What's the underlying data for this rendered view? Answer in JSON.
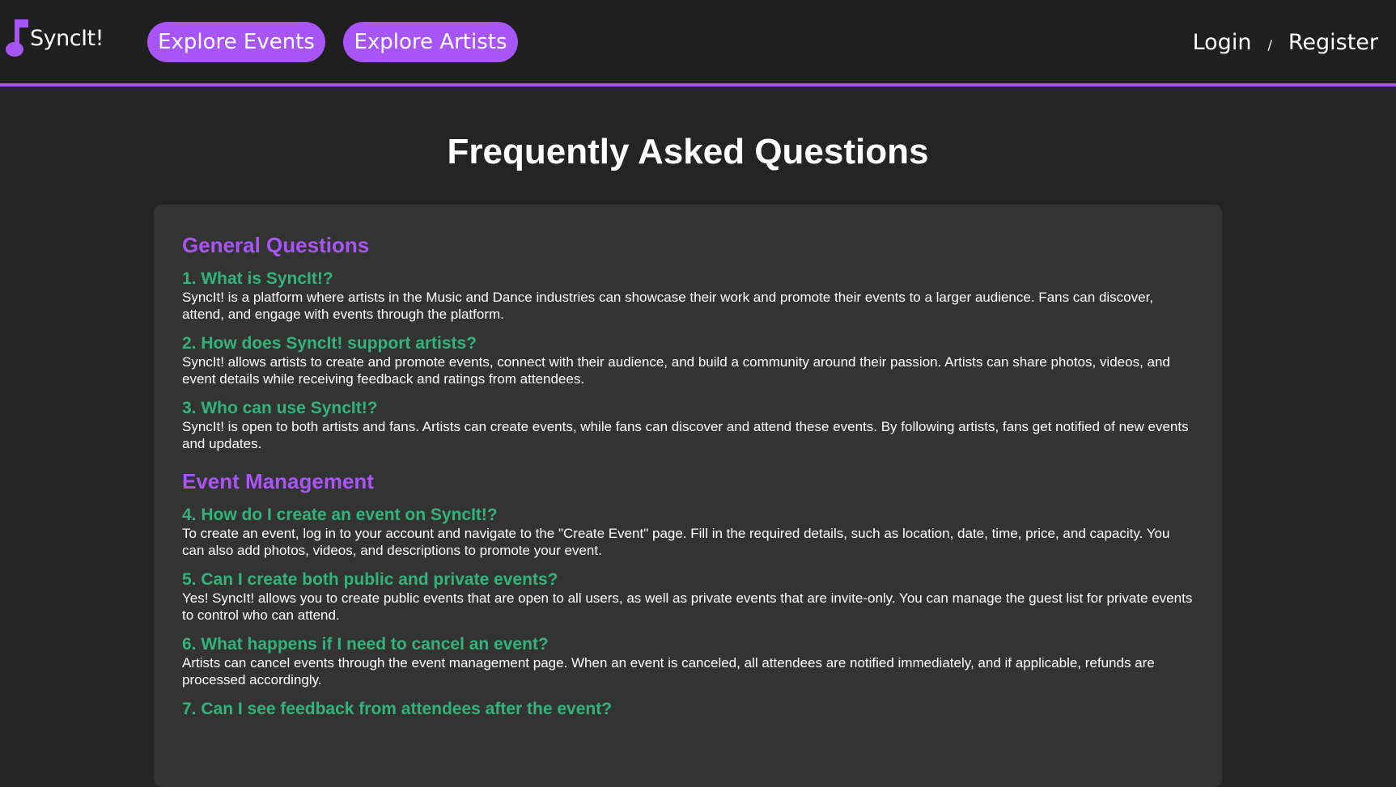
{
  "nav": {
    "logo_text": "SyncIt!",
    "explore_events": "Explore Events",
    "explore_artists": "Explore Artists",
    "login": "Login",
    "separator": "/",
    "register": "Register"
  },
  "colors": {
    "accent": "#a855f7",
    "question": "#34b27d",
    "background": "#242424",
    "card": "#333333"
  },
  "page": {
    "title": "Frequently Asked Questions"
  },
  "sections": [
    {
      "heading": "General Questions",
      "items": [
        {
          "question": "1. What is SyncIt!?",
          "answer": "SyncIt! is a platform where artists in the Music and Dance industries can showcase their work and promote their events to a larger audience. Fans can discover, attend, and engage with events through the platform."
        },
        {
          "question": "2. How does SyncIt! support artists?",
          "answer": "SyncIt! allows artists to create and promote events, connect with their audience, and build a community around their passion. Artists can share photos, videos, and event details while receiving feedback and ratings from attendees."
        },
        {
          "question": "3. Who can use SyncIt!?",
          "answer": "SyncIt! is open to both artists and fans. Artists can create events, while fans can discover and attend these events. By following artists, fans get notified of new events and updates."
        }
      ]
    },
    {
      "heading": "Event Management",
      "items": [
        {
          "question": "4. How do I create an event on SyncIt!?",
          "answer": "To create an event, log in to your account and navigate to the \"Create Event\" page. Fill in the required details, such as location, date, time, price, and capacity. You can also add photos, videos, and descriptions to promote your event."
        },
        {
          "question": "5. Can I create both public and private events?",
          "answer": "Yes! SyncIt! allows you to create public events that are open to all users, as well as private events that are invite-only. You can manage the guest list for private events to control who can attend."
        },
        {
          "question": "6. What happens if I need to cancel an event?",
          "answer": "Artists can cancel events through the event management page. When an event is canceled, all attendees are notified immediately, and if applicable, refunds are processed accordingly."
        },
        {
          "question": "7. Can I see feedback from attendees after the event?",
          "answer": ""
        }
      ]
    }
  ]
}
